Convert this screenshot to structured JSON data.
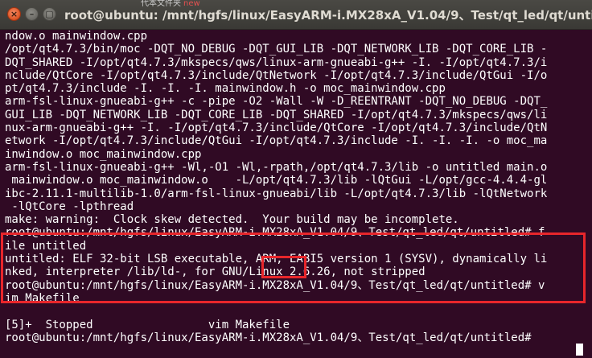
{
  "window": {
    "title": "root@ubuntu: /mnt/hgfs/linux/EasyARM-i.MX28xA_V1.04/9、Test/qt_led/qt/untitled",
    "background_strip": "代本文件夹",
    "background_strip_new": "new",
    "close_symbol": "×",
    "minimize_symbol": "–",
    "maximize_symbol": "▢"
  },
  "colors": {
    "terminal_bg": "#300a24",
    "text": "#ffffff",
    "highlight": "#e8262b"
  },
  "terminal": {
    "lines": [
      "ndow.o mainwindow.cpp",
      "/opt/qt4.7.3/bin/moc -DQT_NO_DEBUG -DQT_GUI_LIB -DQT_NETWORK_LIB -DQT_CORE_LIB -",
      "DQT_SHARED -I/opt/qt4.7.3/mkspecs/qws/linux-arm-gnueabi-g++ -I. -I/opt/qt4.7.3/i",
      "nclude/QtCore -I/opt/qt4.7.3/include/QtNetwork -I/opt/qt4.7.3/include/QtGui -I/o",
      "pt/qt4.7.3/include -I. -I. -I. mainwindow.h -o moc_mainwindow.cpp",
      "arm-fsl-linux-gnueabi-g++ -c -pipe -O2 -Wall -W -D_REENTRANT -DQT_NO_DEBUG -DQT_",
      "GUI_LIB -DQT_NETWORK_LIB -DQT_CORE_LIB -DQT_SHARED -I/opt/qt4.7.3/mkspecs/qws/li",
      "nux-arm-gnueabi-g++ -I. -I/opt/qt4.7.3/include/QtCore -I/opt/qt4.7.3/include/QtN",
      "etwork -I/opt/qt4.7.3/include/QtGui -I/opt/qt4.7.3/include -I. -I. -I. -o moc_ma",
      "inwindow.o moc_mainwindow.cpp",
      "arm-fsl-linux-gnueabi-g++ -Wl,-O1 -Wl,-rpath,/opt/qt4.7.3/lib -o untitled main.o",
      " mainwindow.o moc_mainwindow.o    -L/opt/qt4.7.3/lib -lQtGui -L/opt/gcc-4.4.4-gl",
      "ibc-2.11.1-multilib-1.0/arm-fsl-linux-gnueabi/lib -L/opt/qt4.7.3/lib -lQtNetwork",
      " -lQtCore -lpthread",
      "make: warning:  Clock skew detected.  Your build may be incomplete.",
      "root@ubuntu:/mnt/hgfs/linux/EasyARM-i.MX28xA_V1.04/9、Test/qt_led/qt/untitled# f",
      "ile untitled",
      "untitled: ELF 32-bit LSB executable, ARM, EABI5 version 1 (SYSV), dynamically li",
      "nked, interpreter /lib/ld-, for GNU/Linux 2.6.26, not stripped",
      "root@ubuntu:/mnt/hgfs/linux/EasyARM-i.MX28xA_V1.04/9、Test/qt_led/qt/untitled# v",
      "im Makefile",
      "",
      "[5]+  Stopped                 vim Makefile",
      "root@ubuntu:/mnt/hgfs/linux/EasyARM-i.MX28xA_V1.04/9、Test/qt_led/qt/untitled# "
    ]
  }
}
